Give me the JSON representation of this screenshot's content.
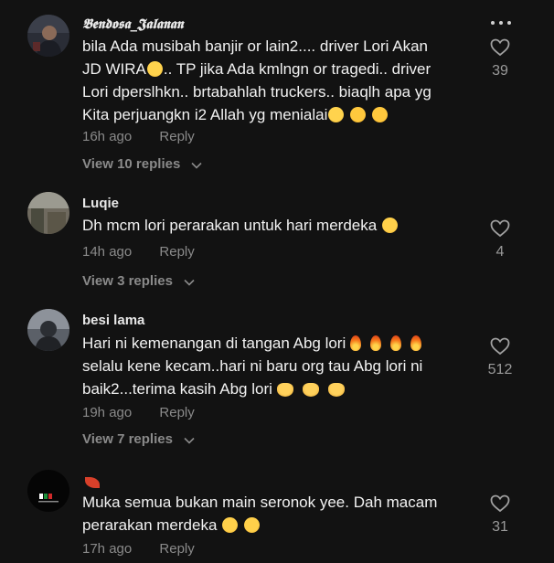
{
  "comments": [
    {
      "username": "𝕭𝖊𝖓𝖉𝖔𝖘𝖆_𝕵𝖆𝖑𝖆𝖓𝖆𝖓",
      "lines": [
        "bila Ada musibah banjir or lain2.... driver Lori Akan",
        "JD WIRA",
        ".. TP jika Ada kmlngn or tragedi.. driver",
        "Lori dperslhkn.. brtabahlah truckers.. biaqlh apa yg",
        "Kita perjuangkn i2 Allah yg menialai"
      ],
      "time": "16h ago",
      "reply": "Reply",
      "view_replies": "View 10 replies",
      "likes": "39"
    },
    {
      "username": "Luqie",
      "text": "Dh mcm lori perarakan untuk hari merdeka",
      "time": "14h ago",
      "reply": "Reply",
      "view_replies": "View 3 replies",
      "likes": "4"
    },
    {
      "username": "besi lama",
      "lines": [
        "Hari ni kemenangan di tangan Abg lori",
        "selalu kene kecam..hari ni baru org tau Abg lori ni",
        "baik2...terima kasih Abg lori"
      ],
      "time": "19h ago",
      "reply": "Reply",
      "view_replies": "View 7 replies",
      "likes": "512"
    },
    {
      "username": "",
      "lines": [
        "Muka semua bukan main seronok yee. Dah macam",
        "perarakan merdeka"
      ],
      "time": "17h ago",
      "reply": "Reply",
      "likes": "31"
    }
  ],
  "icons": {
    "heart": "heart-outline-icon",
    "more": "more-dots-icon",
    "chevron": "chevron-down-icon"
  },
  "colors": {
    "background": "#121212",
    "text": "#f2f2f2",
    "muted": "#8a8a8a"
  }
}
